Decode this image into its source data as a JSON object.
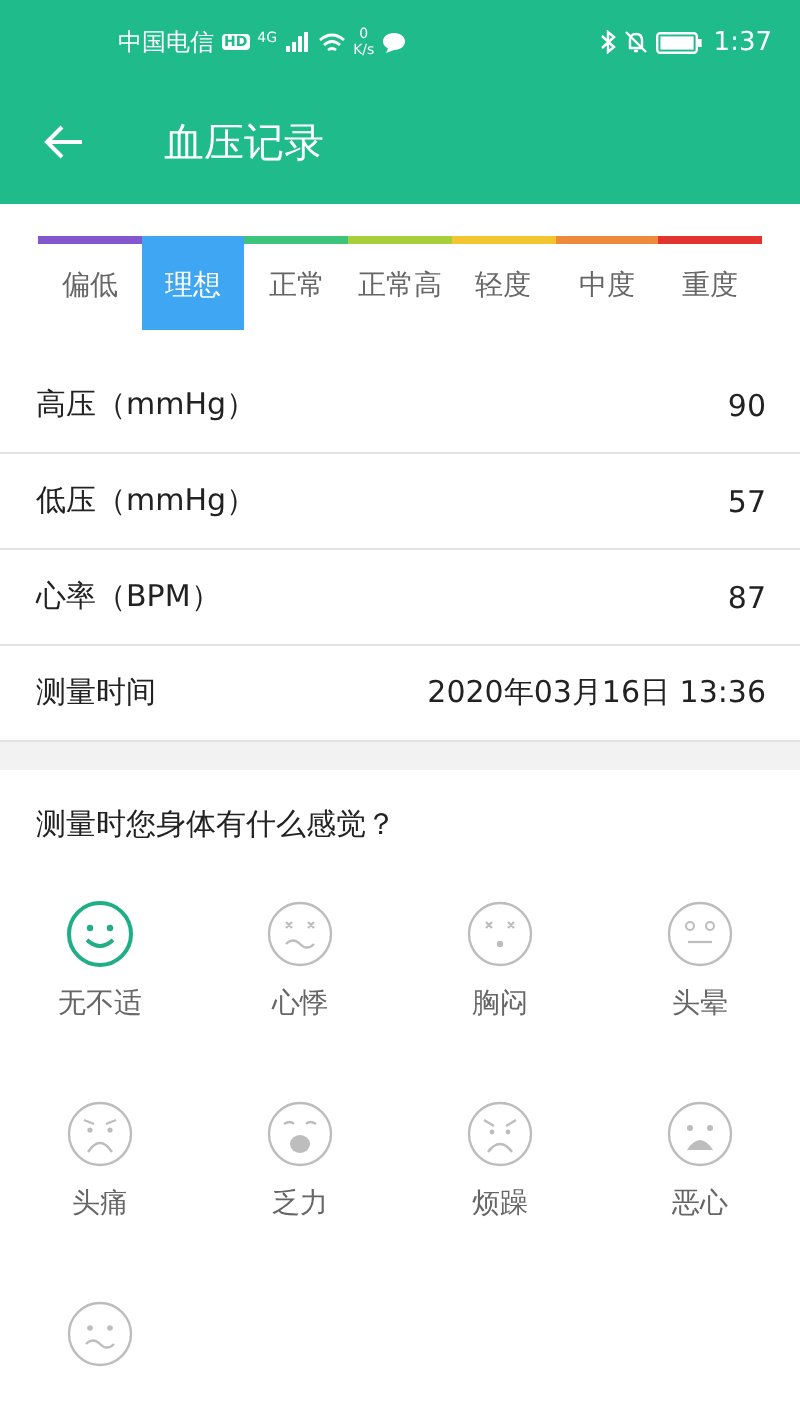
{
  "status_bar": {
    "carrier": "中国电信",
    "hd": "HD",
    "network": "4G",
    "speed_value": "0",
    "speed_unit": "K/s",
    "time": "1:37"
  },
  "header": {
    "title": "血压记录"
  },
  "levels": [
    {
      "label": "偏低",
      "color": "#8456d0",
      "selected": false
    },
    {
      "label": "理想",
      "color": "#3ea6f2",
      "selected": true
    },
    {
      "label": "正常",
      "color": "#3cc47c",
      "selected": false
    },
    {
      "label": "正常高",
      "color": "#a8cf3a",
      "selected": false
    },
    {
      "label": "轻度",
      "color": "#f2c531",
      "selected": false
    },
    {
      "label": "中度",
      "color": "#ef8a3a",
      "selected": false
    },
    {
      "label": "重度",
      "color": "#e3342f",
      "selected": false
    }
  ],
  "readings": [
    {
      "label": "高压（mmHg）",
      "value": "90"
    },
    {
      "label": "低压（mmHg）",
      "value": "57"
    },
    {
      "label": "心率（BPM）",
      "value": "87"
    },
    {
      "label": "测量时间",
      "value": "2020年03月16日 13:36"
    }
  ],
  "question": "测量时您身体有什么感觉？",
  "symptoms": [
    {
      "kind": "smile",
      "label": "无不适",
      "selected": true
    },
    {
      "kind": "dizzy",
      "label": "心悸",
      "selected": false
    },
    {
      "kind": "stunned",
      "label": "胸闷",
      "selected": false
    },
    {
      "kind": "blank",
      "label": "头晕",
      "selected": false
    },
    {
      "kind": "sad",
      "label": "头痛",
      "selected": false
    },
    {
      "kind": "yawn",
      "label": "乏力",
      "selected": false
    },
    {
      "kind": "angry",
      "label": "烦躁",
      "selected": false
    },
    {
      "kind": "gasp",
      "label": "恶心",
      "selected": false
    },
    {
      "kind": "queasy",
      "selected": false
    }
  ]
}
